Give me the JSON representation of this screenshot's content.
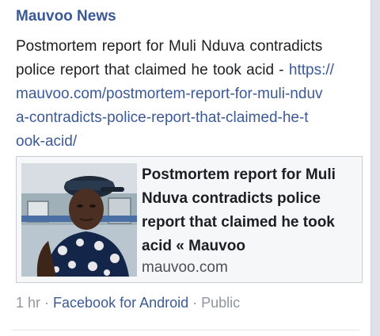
{
  "post": {
    "page_name": "Mauvoo News",
    "text_lines": [
      "Postmortem  report for  Muli Nduva contradicts",
      "police report that claimed  he took acid - "
    ],
    "link_lines": [
      "https://",
      "mauvoo.com/postmortem-report-for-muli-nduv",
      "a-contradicts-police-report-that-claimed-he-t",
      "ook-acid/"
    ]
  },
  "preview": {
    "title_lines": [
      "Postmortem report for Muli",
      "Nduva contradicts police",
      "report that claimed he took",
      "acid « Mauvoo"
    ],
    "domain": "mauvoo.com"
  },
  "meta": {
    "time": "1 hr",
    "sep1": " · ",
    "app": "Facebook for Android",
    "sep2": " · ",
    "privacy": "Public"
  },
  "colors": {
    "link": "#3b5998",
    "text": "#1c1e21",
    "meta": "#90949c",
    "background": "#dfe1e6"
  }
}
